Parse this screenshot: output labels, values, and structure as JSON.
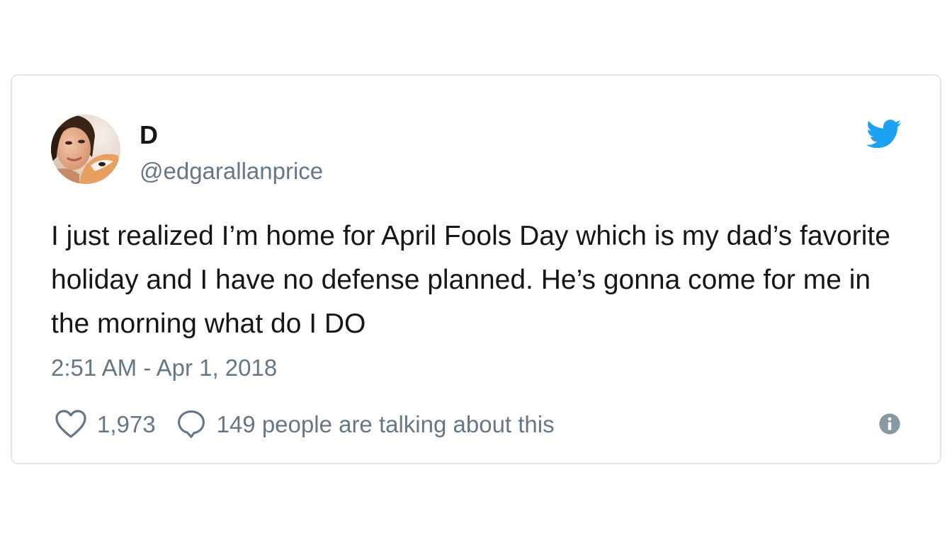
{
  "author": {
    "display_name": "D",
    "handle": "@edgarallanprice",
    "avatar_icon": "profile-photo"
  },
  "tweet": {
    "text": "I just realized I’m home for April Fools Day which is my dad’s favorite holiday and I have no defense planned. He’s gonna come for me in the morning what do I DO",
    "timestamp": "2:51 AM - Apr 1, 2018"
  },
  "actions": {
    "like_count": "1,973",
    "like_icon": "heart-outline-icon",
    "reply_text": "149 people are talking about this",
    "reply_icon": "speech-bubble-icon",
    "info_icon": "info-icon"
  },
  "brand": {
    "logo_icon": "twitter-bird-icon",
    "accent": "#1da1f2"
  },
  "colors": {
    "text_primary": "#14171a",
    "text_secondary": "#657786",
    "border": "#e1e8ed"
  }
}
